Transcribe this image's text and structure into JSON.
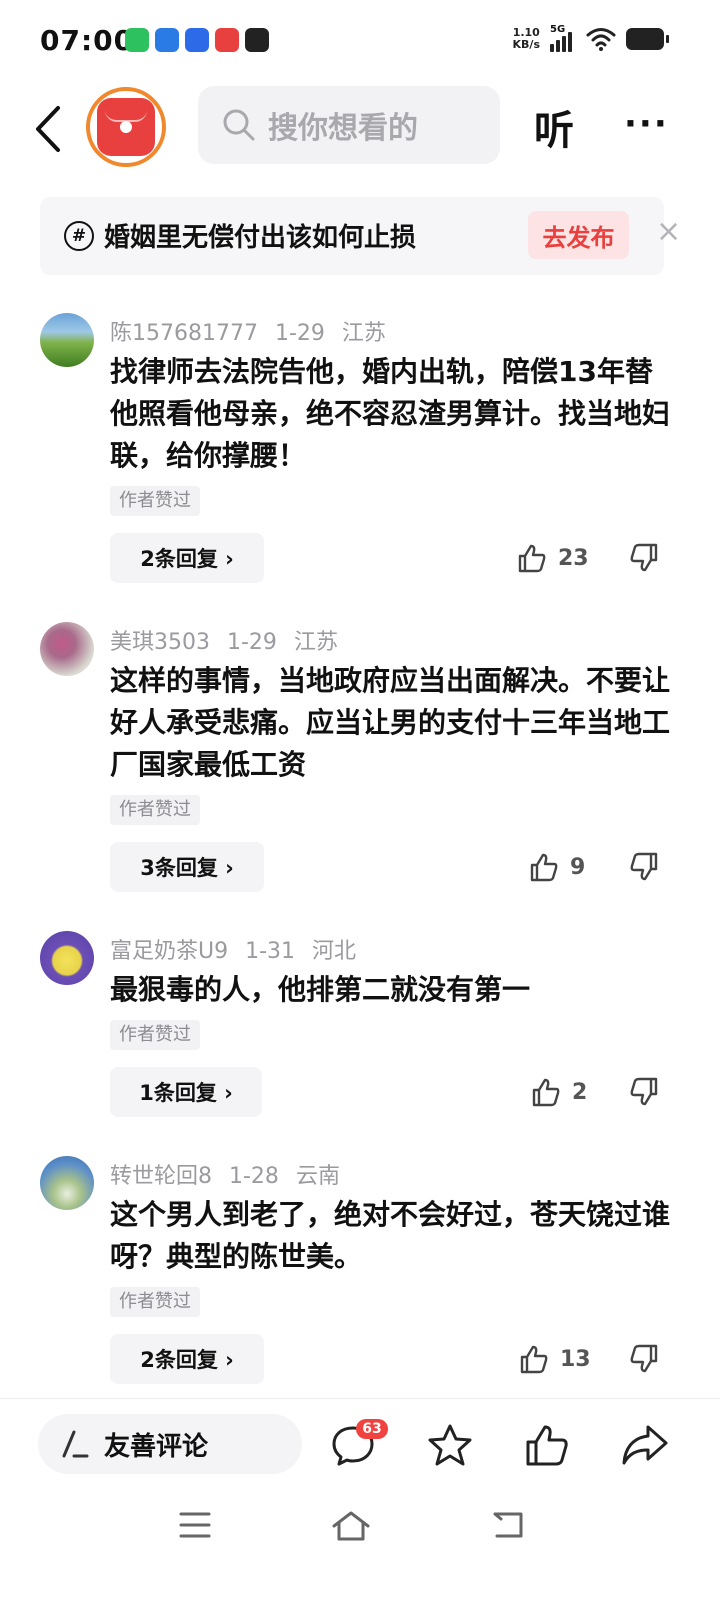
{
  "status_bar": {
    "time": "07:00",
    "net_speed_value": "1.10",
    "net_speed_unit": "KB/s",
    "signal_label": "5G",
    "app_icons": [
      "wechat-icon",
      "notes-app-icon",
      "baidu-icon",
      "video-app-icon",
      "toutiao-app-icon"
    ],
    "app_colors": [
      "#2dc15f",
      "#2a7be4",
      "#2d6ae8",
      "#e8403f",
      "#222222"
    ]
  },
  "header": {
    "search_placeholder": "搜你想看的",
    "listen_label": "听",
    "more_label": "···"
  },
  "topic": {
    "hash": "#",
    "text": "婚姻里无偿付出该如何止损",
    "publish_label": "去发布",
    "close_label": "×"
  },
  "comments": [
    {
      "username": "陈157681777",
      "date": "1-29",
      "location": "江苏",
      "text": "找律师去法院告他，婚内出轨，陪偿13年替他照看他母亲，绝不容忍渣男算计。找当地妇联，给你撑腰！",
      "badge": "作者赞过",
      "replies": "2条回复 ›",
      "likes": "23"
    },
    {
      "username": "美琪3503",
      "date": "1-29",
      "location": "江苏",
      "text": "这样的事情，当地政府应当出面解决。不要让好人承受悲痛。应当让男的支付十三年当地工厂国家最低工资",
      "badge": "作者赞过",
      "replies": "3条回复 ›",
      "likes": "9"
    },
    {
      "username": "富足奶茶U9",
      "date": "1-31",
      "location": "河北",
      "text": "最狠毒的人，他排第二就没有第一",
      "badge": "作者赞过",
      "replies": "1条回复 ›",
      "likes": "2"
    },
    {
      "username": "转世轮回8",
      "date": "1-28",
      "location": "云南",
      "text": "这个男人到老了，绝对不会好过，苍天饶过谁呀？典型的陈世美。",
      "badge": "作者赞过",
      "replies": "2条回复 ›",
      "likes": "13"
    }
  ],
  "bottom_bar": {
    "compose_label": "友善评论",
    "comment_count": "63"
  },
  "colors": {
    "accent_red": "#e8403f",
    "avatar_ring": "#f0892e",
    "meta_gray": "#9a9a9f"
  }
}
